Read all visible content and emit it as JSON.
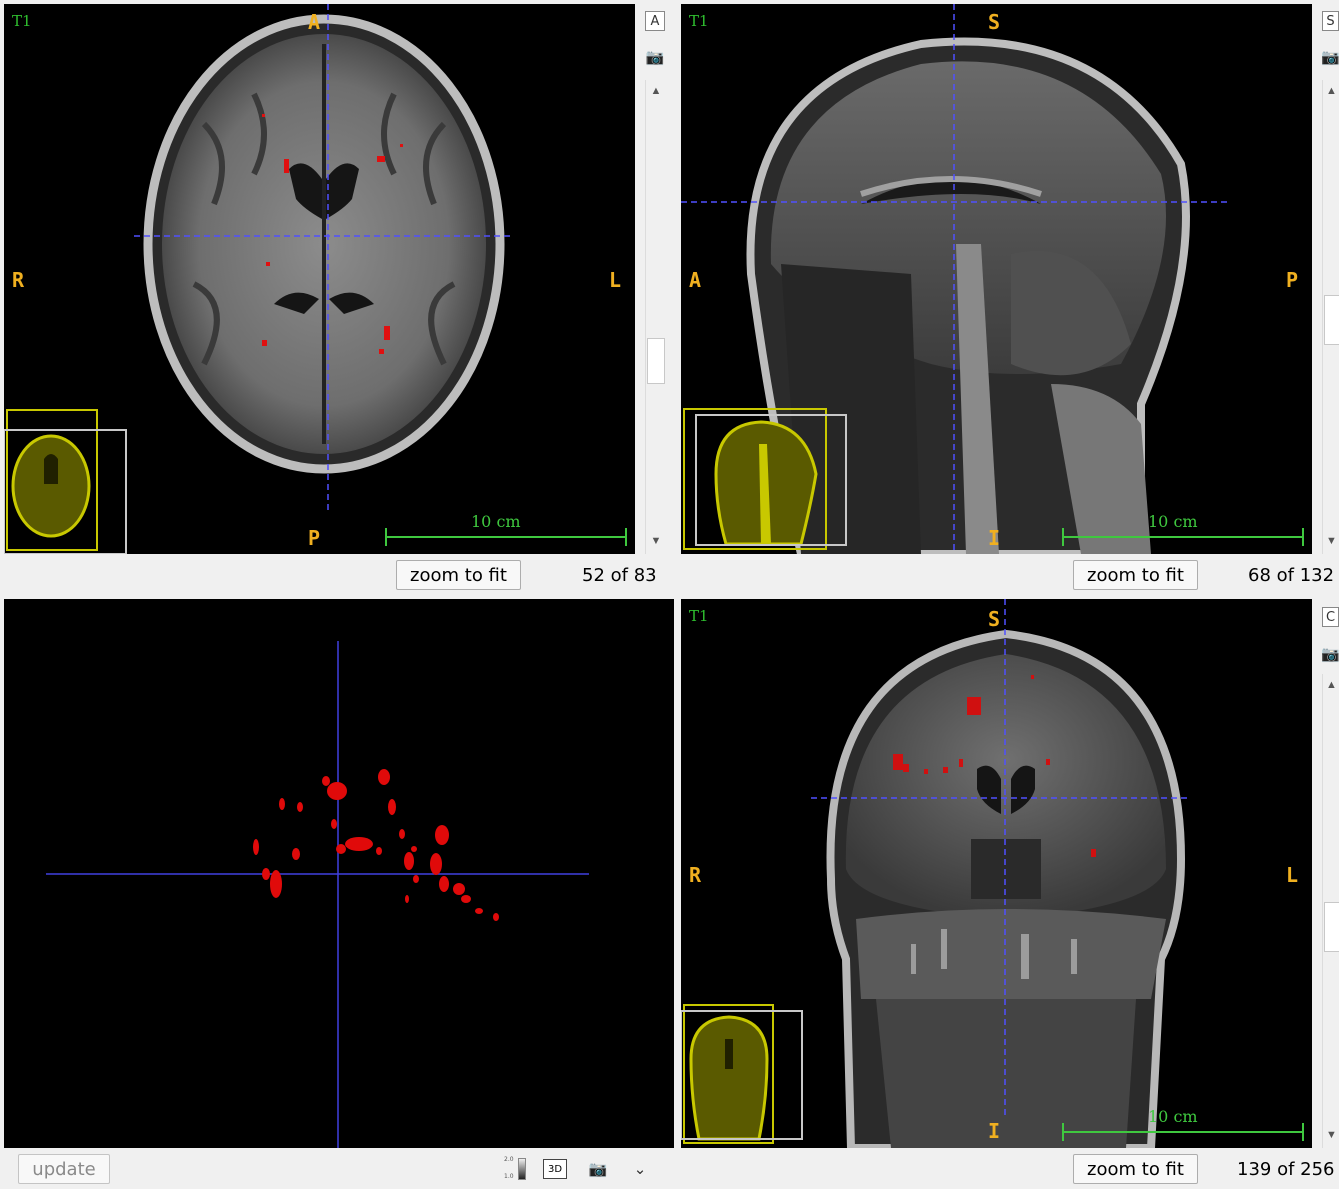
{
  "axial": {
    "sequence": "T1",
    "orient": {
      "top": "A",
      "bottom": "P",
      "left": "R",
      "right": "L"
    },
    "scale": "10 cm",
    "icons": {
      "view_letter": "A",
      "snapshot": "camera-icon"
    },
    "zoom_button": "zoom to fit",
    "slice": "52 of 83"
  },
  "sagittal": {
    "sequence": "T1",
    "orient": {
      "top": "S",
      "bottom": "I",
      "left": "A",
      "right": "P"
    },
    "scale": "10 cm",
    "icons": {
      "view_letter": "S",
      "snapshot": "camera-icon"
    },
    "zoom_button": "zoom to fit",
    "slice": "68 of 132"
  },
  "coronal": {
    "sequence": "T1",
    "orient": {
      "top": "S",
      "bottom": "I",
      "left": "R",
      "right": "L"
    },
    "scale": "10 cm",
    "icons": {
      "view_letter": "C",
      "snapshot": "camera-icon"
    },
    "zoom_button": "zoom to fit",
    "slice": "139 of 256"
  },
  "render3d": {
    "update_button": "update",
    "toolbar": {
      "range_top": "2.0",
      "range_bottom": "1.0",
      "mode_3d": "3D"
    }
  },
  "colors": {
    "crosshair": "#5050ff",
    "orient": "#f0b020",
    "scale": "#3fc83f",
    "lesion": "#e01010",
    "thumb_frame": "#c8c800"
  }
}
